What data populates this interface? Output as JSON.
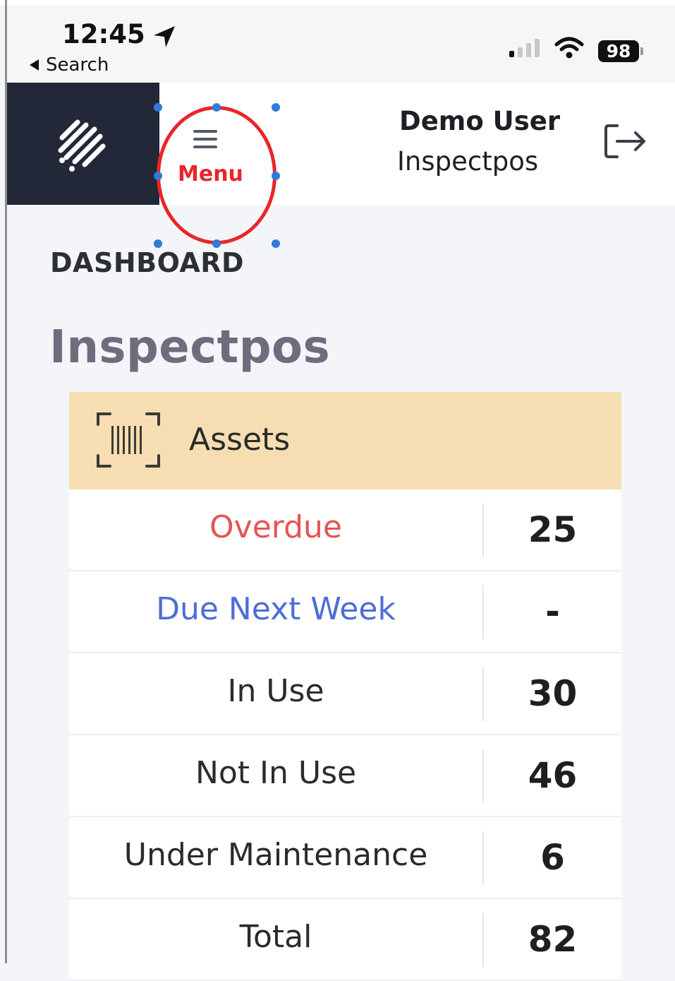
{
  "status_bar": {
    "time": "12:45",
    "back_label": "Search",
    "battery": "98"
  },
  "header": {
    "menu_label": "Menu",
    "user_name": "Demo User",
    "user_org": "Inspectpos"
  },
  "page": {
    "section_title": "DASHBOARD",
    "company_title": "Inspectpos"
  },
  "assets_card": {
    "title": "Assets",
    "rows": [
      {
        "label": "Overdue",
        "value": "25"
      },
      {
        "label": "Due Next Week",
        "value": "-"
      },
      {
        "label": "In Use",
        "value": "30"
      },
      {
        "label": "Not In Use",
        "value": "46"
      },
      {
        "label": "Under Maintenance",
        "value": "6"
      },
      {
        "label": "Total",
        "value": "82"
      }
    ]
  },
  "colors": {
    "header_dark": "#222838",
    "menu_red": "#e8262a",
    "overdue": "#e45454",
    "due_next_week": "#4d6dd8",
    "card_header": "#f7deb2"
  }
}
